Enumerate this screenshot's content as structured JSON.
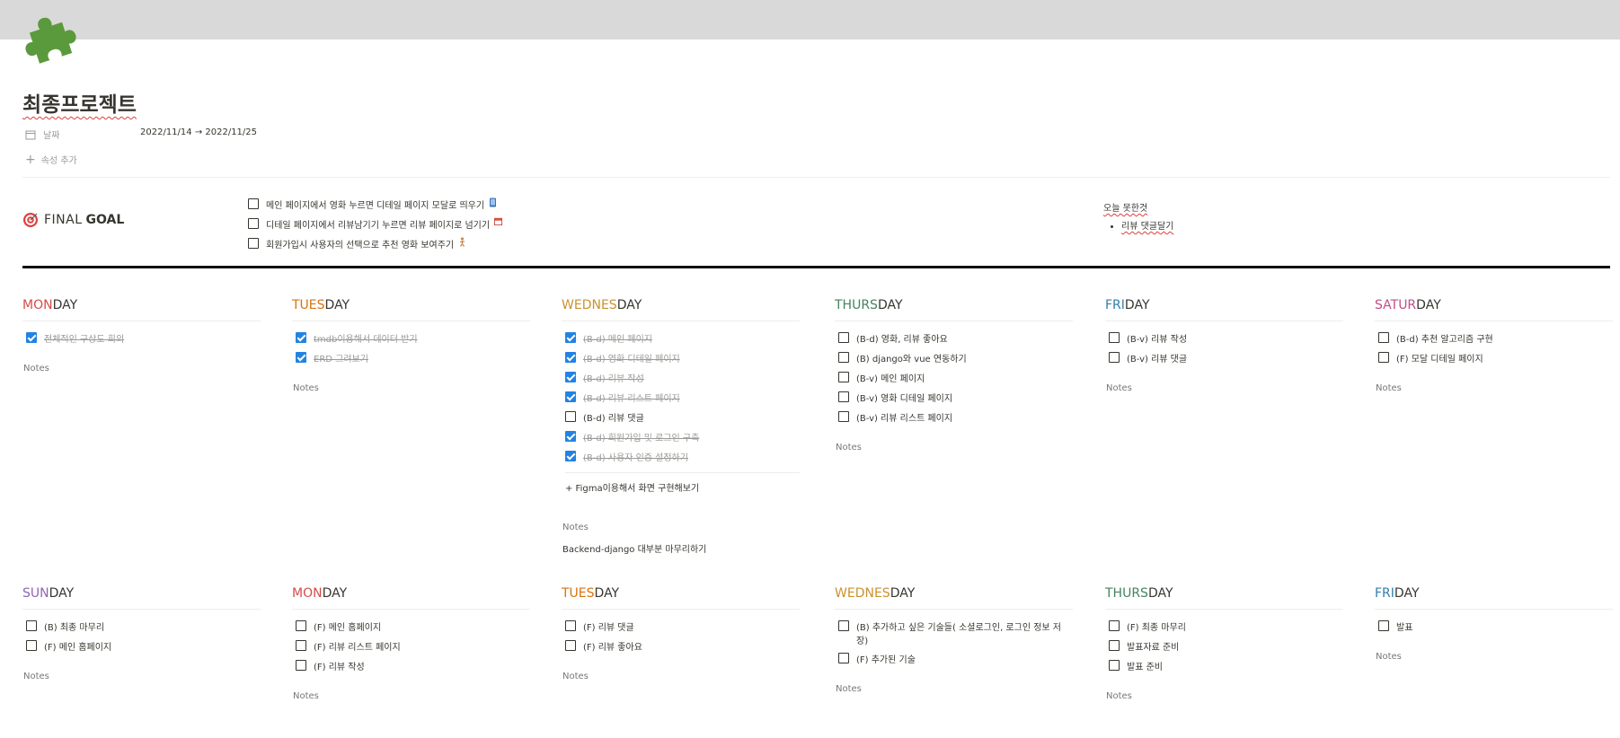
{
  "page": {
    "title": "최종프로젝트"
  },
  "properties": {
    "date_label": "날짜",
    "date_value": "2022/11/14 → 2022/11/25",
    "add_property": "속성 추가"
  },
  "final_goal": {
    "label_final": "FINAL",
    "label_goal": "GOAL",
    "items": [
      {
        "text": "메인 페이지에서 영화 누르면 디테일 페이지 모달로 띄우기",
        "checked": false,
        "emoji": "phone-icon"
      },
      {
        "text": "디테일 페이지에서 리뷰남기기 누르면 리뷰 페이지로 넘기기",
        "checked": false,
        "emoji": "calendar-icon"
      },
      {
        "text": "회원가입시 사용자의 선택으로 추천 영화 보여주기",
        "checked": false,
        "emoji": "person-icon"
      }
    ]
  },
  "not_done": {
    "title": "오늘 못한것",
    "items": [
      "리뷰 댓글달기"
    ]
  },
  "notes_label": "Notes",
  "week1": [
    {
      "pre": "MON",
      "post": "DAY",
      "color": "#d44c47",
      "items": [
        {
          "text": "전체적인 구상도 회의",
          "checked": true
        }
      ]
    },
    {
      "pre": "TUES",
      "post": "DAY",
      "color": "#d9730d",
      "items": [
        {
          "text": "tmdb이용해서 데이터 받기",
          "checked": true
        },
        {
          "text": "ERD 그려보기",
          "checked": true
        }
      ]
    },
    {
      "pre": "WEDNES",
      "post": "DAY",
      "color": "#cb912f",
      "items": [
        {
          "text": "(B-d) 메인 페이지",
          "checked": true
        },
        {
          "text": "(B-d) 영화 디테일 페이지",
          "checked": true
        },
        {
          "text": "(B-d) 리뷰 작성",
          "checked": true
        },
        {
          "text": "(B-d) 리뷰 리스트 페이지",
          "checked": true
        },
        {
          "text": "(B-d) 리뷰 댓글",
          "checked": false
        },
        {
          "text": "(B-d) 회원가입 및 로그인 구축",
          "checked": true
        },
        {
          "text": "(B-d) 사용자 인증 설정하기",
          "checked": true
        }
      ],
      "add_item": "+ Figma이용해서 화면 구현해보기",
      "notes_text": "Backend-django 대부분 마무리하기"
    },
    {
      "pre": "THURS",
      "post": "DAY",
      "color": "#448361",
      "items": [
        {
          "text": "(B-d) 영화, 리뷰 좋아요",
          "checked": false
        },
        {
          "text": "(B) django와 vue 연동하기",
          "checked": false
        },
        {
          "text": "(B-v) 메인 페이지",
          "checked": false
        },
        {
          "text": "(B-v) 영화 디테일 페이지",
          "checked": false
        },
        {
          "text": "(B-v) 리뷰 리스트 페이지",
          "checked": false
        }
      ]
    },
    {
      "pre": "FRI",
      "post": "DAY",
      "color": "#337ea9",
      "items": [
        {
          "text": "(B-v) 리뷰 작성",
          "checked": false
        },
        {
          "text": "(B-v) 리뷰 댓글",
          "checked": false
        }
      ]
    },
    {
      "pre": "SATUR",
      "post": "DAY",
      "color": "#c14c8a",
      "items": [
        {
          "text": "(B-d) 추천 알고리즘 구현",
          "checked": false
        },
        {
          "text": "(F) 모달 디테일 페이지",
          "checked": false
        }
      ]
    }
  ],
  "week2": [
    {
      "pre": "SUN",
      "post": "DAY",
      "color": "#9065b0",
      "items": [
        {
          "text": "(B) 최종 마무리",
          "checked": false
        },
        {
          "text": "(F) 메인 홈페이지",
          "checked": false
        }
      ]
    },
    {
      "pre": "MON",
      "post": "DAY",
      "color": "#d44c47",
      "items": [
        {
          "text": "(F) 메인 홈페이지",
          "checked": false
        },
        {
          "text": "(F) 리뷰 리스트 페이지",
          "checked": false
        },
        {
          "text": "(F) 리뷰 작성",
          "checked": false
        }
      ]
    },
    {
      "pre": "TUES",
      "post": "DAY",
      "color": "#d9730d",
      "items": [
        {
          "text": "(F) 리뷰 댓글",
          "checked": false
        },
        {
          "text": "(F) 리뷰 좋아요",
          "checked": false
        }
      ]
    },
    {
      "pre": "WEDNES",
      "post": "DAY",
      "color": "#cb912f",
      "items": [
        {
          "text": "(B) 추가하고 싶은 기술들( 소셜로그인, 로그인 정보 저장)",
          "checked": false
        },
        {
          "text": "(F) 추가된 기술",
          "checked": false
        }
      ]
    },
    {
      "pre": "THURS",
      "post": "DAY",
      "color": "#448361",
      "items": [
        {
          "text": "(F) 최종 마무리",
          "checked": false
        },
        {
          "text": "발표자료 준비",
          "checked": false
        },
        {
          "text": "발표 준비",
          "checked": false
        }
      ]
    },
    {
      "pre": "FRI",
      "post": "DAY",
      "color": "#337ea9",
      "items": [
        {
          "text": "발표",
          "checked": false
        }
      ]
    }
  ]
}
